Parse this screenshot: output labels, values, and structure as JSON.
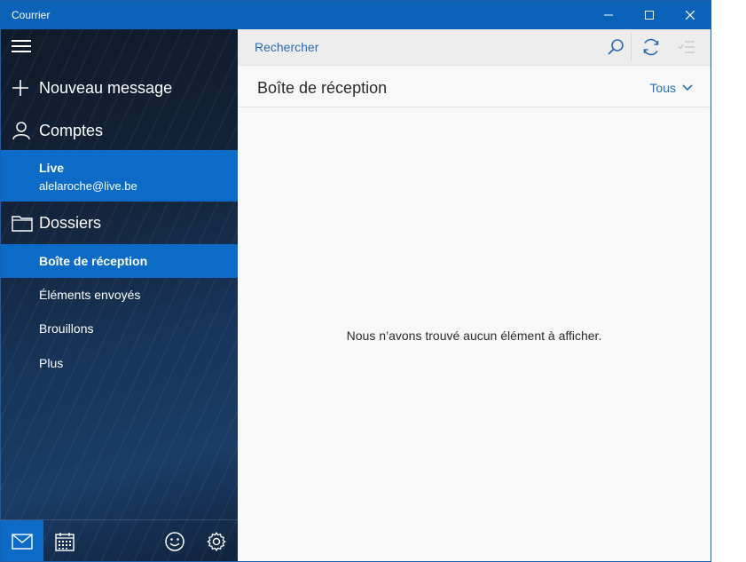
{
  "window": {
    "title": "Courrier",
    "controls": {
      "minimize": "minimize-icon",
      "maximize": "maximize-icon",
      "close": "close-icon"
    }
  },
  "sidebar": {
    "new_message": "Nouveau message",
    "accounts_label": "Comptes",
    "account": {
      "name": "Live",
      "email": "alelaroche@live.be"
    },
    "folders_label": "Dossiers",
    "folders": [
      {
        "label": "Boîte de réception",
        "selected": true
      },
      {
        "label": "Éléments envoyés",
        "selected": false
      },
      {
        "label": "Brouillons",
        "selected": false
      },
      {
        "label": "Plus",
        "selected": false
      }
    ],
    "bottom_icons": [
      "mail-icon",
      "calendar-icon",
      "smiley-icon",
      "gear-icon"
    ]
  },
  "main": {
    "search_placeholder": "Rechercher",
    "toolbar_icons": [
      "search-icon",
      "sync-icon",
      "select-mode-icon"
    ],
    "folder_title": "Boîte de réception",
    "filter_label": "Tous",
    "empty_message": "Nous n’avons trouvé aucun élément à afficher."
  },
  "colors": {
    "titlebar": "#0a63b8",
    "accent": "#0b6bc6",
    "link": "#2a6bb0"
  }
}
